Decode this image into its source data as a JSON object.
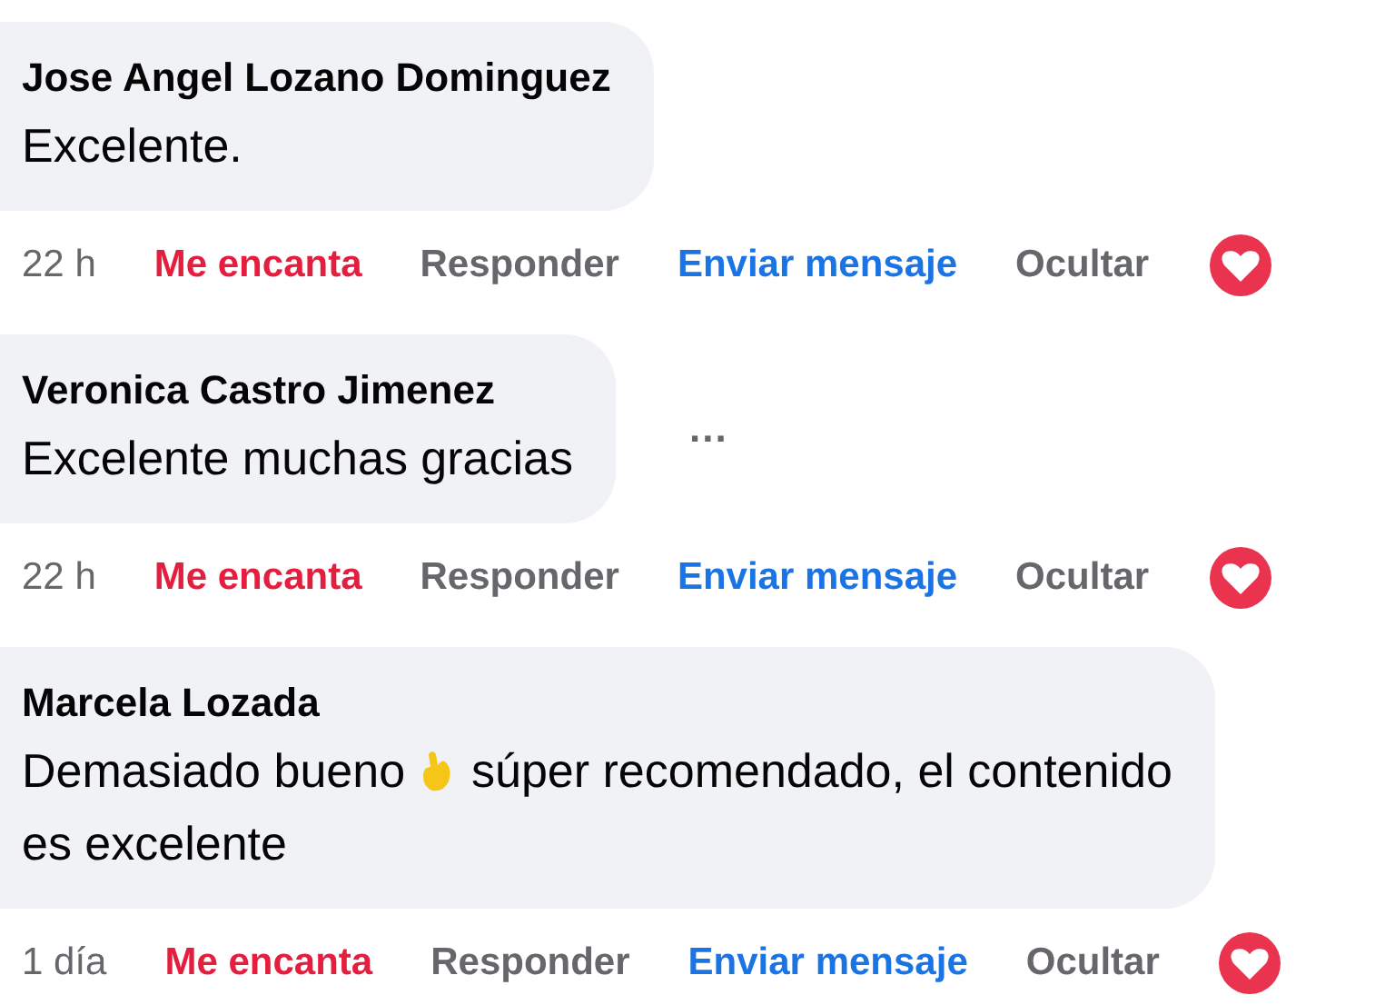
{
  "comments": [
    {
      "author": "Jose Angel Lozano Dominguez",
      "lines": [
        [
          {
            "kind": "text",
            "text": "Excelente."
          }
        ]
      ],
      "actions": {
        "time": "22 h",
        "love": "Me encanta",
        "love_selected": true,
        "reply": "Responder",
        "message": "Enviar mensaje",
        "hide": "Ocultar"
      }
    },
    {
      "author": "Veronica Castro Jimenez",
      "lines": [
        [
          {
            "kind": "text",
            "text": "Excelente muchas gracias"
          }
        ]
      ],
      "more": "...",
      "actions": {
        "time": "22 h",
        "love": "Me encanta",
        "love_selected": true,
        "reply": "Responder",
        "message": "Enviar mensaje",
        "hide": "Ocultar"
      }
    },
    {
      "author": "Marcela Lozada",
      "lines": [
        [
          {
            "kind": "text",
            "text": "Demasiado bueno "
          },
          {
            "kind": "emoji"
          },
          {
            "kind": "text",
            "text": " súper recomendado, el contenido"
          }
        ],
        [
          {
            "kind": "text",
            "text": "es excelente"
          }
        ]
      ],
      "actions": {
        "time": "1 día",
        "love": "Me encanta",
        "love_selected": true,
        "reply": "Responder",
        "message": "Enviar mensaje",
        "hide": "Ocultar"
      }
    }
  ]
}
